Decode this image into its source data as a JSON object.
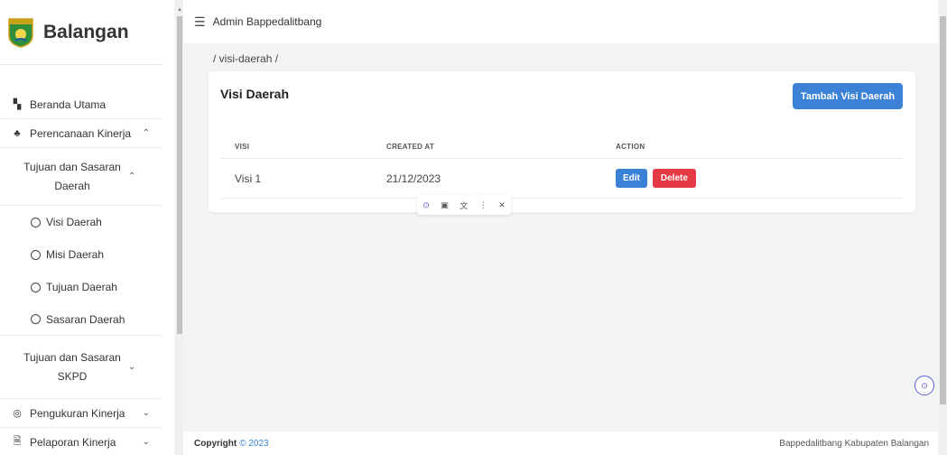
{
  "brand": {
    "name": "Balangan",
    "logo_label": "BALANGAN"
  },
  "sidebar": {
    "items": [
      {
        "label": "Beranda Utama",
        "icon": "dashboard-icon"
      },
      {
        "label": "Perencanaan Kinerja",
        "icon": "hierarchy-icon",
        "expanded": true
      },
      {
        "label": "Pengukuran Kinerja",
        "icon": "target-icon"
      },
      {
        "label": "Pelaporan Kinerja",
        "icon": "document-icon"
      }
    ],
    "sub_groups": [
      {
        "label": "Tujuan dan Sasaran Daerah",
        "expanded": true
      },
      {
        "label": "Tujuan dan Sasaran SKPD",
        "expanded": false
      }
    ],
    "leaves": [
      "Visi Daerah",
      "Misi Daerah",
      "Tujuan Daerah",
      "Sasaran Daerah"
    ]
  },
  "topbar": {
    "title": "Admin Bappedalitbang"
  },
  "breadcrumb": "/ visi-daerah /",
  "card": {
    "title": "Visi Daerah",
    "add_button": "Tambah Visi Daerah",
    "columns": [
      "VISI",
      "CREATED AT",
      "ACTION"
    ],
    "rows": [
      {
        "visi": "Visi 1",
        "created_at": "21/12/2023",
        "edit": "Edit",
        "delete": "Delete"
      }
    ]
  },
  "footer": {
    "copyright": "Copyright",
    "year": "© 2023",
    "right": "Bappedalitbang Kabupaten Balangan"
  },
  "colors": {
    "primary": "#3b82d6",
    "danger": "#e53945"
  }
}
